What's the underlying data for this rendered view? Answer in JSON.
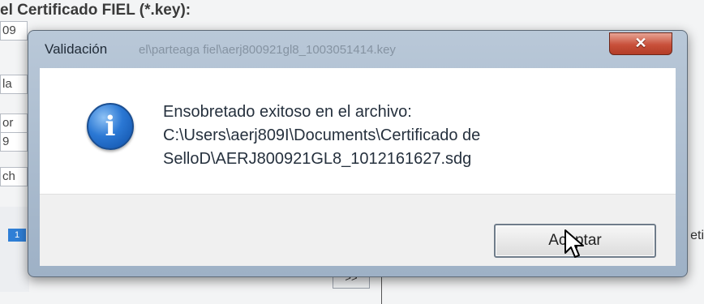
{
  "background": {
    "title_label": "el Certificado FIEL (*.key):",
    "field_1": "09",
    "field_2": "la",
    "field_3": "or",
    "field_4": "9",
    "field_5": "ch",
    "chip": "1",
    "right_text": "eti",
    "small_box": ">>"
  },
  "dialog": {
    "title": "Validación",
    "title_path": "el\\parteaga fiel\\aerj800921gl8_1003051414.key",
    "close_label": "✕",
    "icon": "info-icon",
    "message_line_1": "Ensobretado exitoso en el archivo:",
    "message_line_2": "C:\\Users\\aerj809I\\Documents\\Certificado de",
    "message_line_3": "SelloD\\AERJ800921GL8_1012161627.sdg",
    "ok_label": "Aceptar"
  },
  "colors": {
    "close_red": "#c8503a",
    "info_blue": "#2b78d4",
    "frame": "#9eb1c6"
  }
}
